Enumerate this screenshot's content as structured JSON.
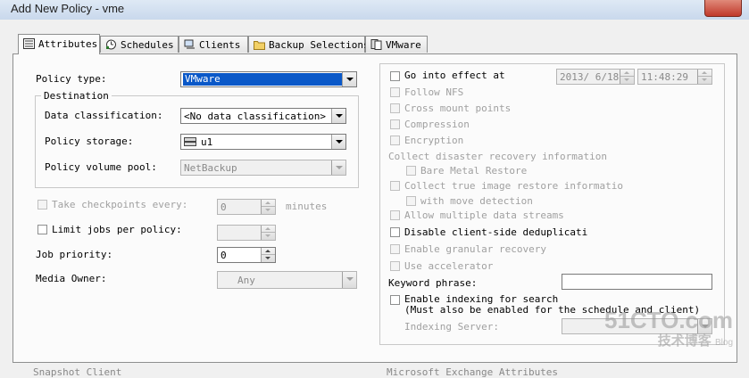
{
  "window": {
    "title": "Add New Policy - vme"
  },
  "tabs": [
    {
      "label": "Attributes",
      "icon": "attributes-icon"
    },
    {
      "label": "Schedules",
      "icon": "schedules-icon"
    },
    {
      "label": "Clients",
      "icon": "clients-icon"
    },
    {
      "label": "Backup Selections",
      "icon": "folder-icon"
    },
    {
      "label": "VMware",
      "icon": "vmware-icon"
    }
  ],
  "left": {
    "policy_type": {
      "label": "Policy type:",
      "value": "VMware"
    },
    "destination": {
      "legend": "Destination",
      "data_classification": {
        "label": "Data classification:",
        "value": "<No data classification>"
      },
      "policy_storage": {
        "label": "Policy storage:",
        "value": "u1"
      },
      "policy_volume_pool": {
        "label": "Policy volume pool:",
        "value": "NetBackup"
      }
    },
    "take_checkpoints": {
      "label": "Take checkpoints every:",
      "value": "0",
      "unit": "minutes"
    },
    "limit_jobs": {
      "label": "Limit jobs per policy:",
      "value": ""
    },
    "job_priority": {
      "label": "Job priority:",
      "value": "0"
    },
    "media_owner": {
      "label": "Media Owner:",
      "value": "Any"
    },
    "bottom_cut_label": "Snapshot Client"
  },
  "right": {
    "go_into_effect": {
      "label": "Go into effect at",
      "date": "2013/ 6/18",
      "time": "11:48:29"
    },
    "follow_nfs": "Follow NFS",
    "cross_mount": "Cross mount points",
    "compression": "Compression",
    "encryption": "Encryption",
    "collect_dr": "Collect disaster recovery information",
    "bare_metal": "Bare Metal Restore",
    "collect_true_image": "Collect true image restore informatio",
    "move_detection": "with move detection",
    "multiple_streams": "Allow multiple data streams",
    "disable_dedup": "Disable client-side deduplicati",
    "granular": "Enable granular recovery",
    "accelerator": "Use accelerator",
    "keyword": {
      "label": "Keyword phrase:",
      "value": ""
    },
    "enable_indexing": "Enable indexing for search",
    "indexing_note": "(Must also be enabled for the schedule and client)",
    "indexing_server": {
      "label": "Indexing Server:",
      "value": ""
    },
    "bottom_cut_label": "Microsoft Exchange Attributes"
  },
  "watermark": {
    "line1": "51CTO.com",
    "line2": "技术博客",
    "line3": "Blog"
  },
  "colors": {
    "selection": "#0a58c8",
    "disabled_text": "#a0a0a0"
  }
}
